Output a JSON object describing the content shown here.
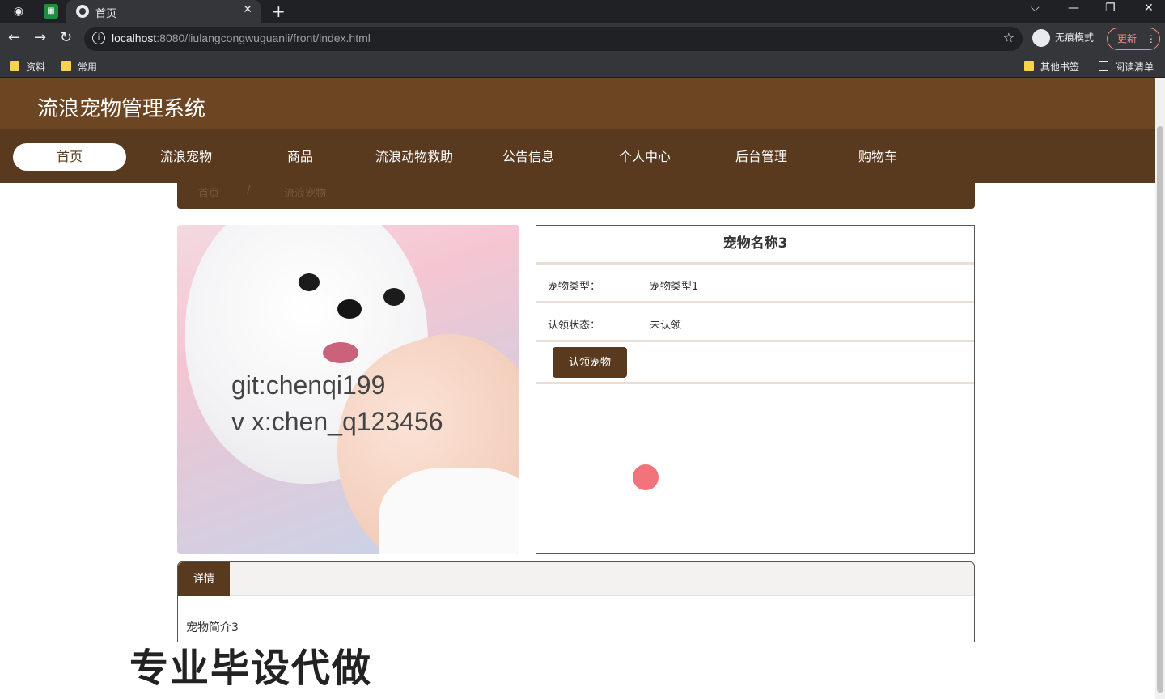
{
  "browser": {
    "tab_title": "首页",
    "url_host": "localhost",
    "url_rest": ":8080/liulangcongwuguanli/front/index.html",
    "incognito_label": "无痕模式",
    "update_label": "更新",
    "bookmarks": [
      "资料",
      "常用"
    ],
    "other_bookmarks": "其他书签",
    "reading_list": "阅读清单"
  },
  "site": {
    "title": "流浪宠物管理系统",
    "nav": [
      "首页",
      "流浪宠物",
      "商品",
      "流浪动物救助",
      "公告信息",
      "个人中心",
      "后台管理",
      "购物车"
    ],
    "breadcrumb": [
      "首页",
      "/",
      "流浪宠物"
    ]
  },
  "pet": {
    "name": "宠物名称3",
    "type_label": "宠物类型：",
    "type_value": "宠物类型1",
    "status_label": "认领状态：",
    "status_value": "未认领",
    "adopt_button": "认领宠物",
    "watermark_1": "git:chenqi199",
    "watermark_2": "v x:chen_q123456"
  },
  "detail": {
    "tab": "详情",
    "intro": "宠物简介3"
  },
  "overlay": "专业毕设代做",
  "colors": {
    "header": "#6c4522",
    "nav": "#5a3a1f",
    "accent": "#5a3a1f"
  }
}
